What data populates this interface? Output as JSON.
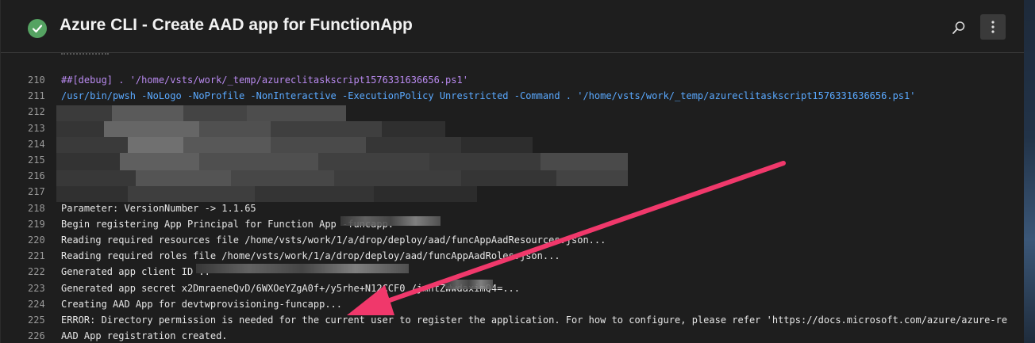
{
  "header": {
    "title": "Azure CLI - Create AAD app for FunctionApp",
    "status_icon": "success-check-icon",
    "search_icon": "search-icon",
    "more_icon": "more-vertical-icon"
  },
  "colors": {
    "success": "#55a362",
    "debug_text": "#b98af0",
    "command_text": "#5aa9ff",
    "arrow": "#f0386b"
  },
  "log": {
    "lines": [
      {
        "n": "210",
        "text": "##[debug]   . '/home/vsts/work/_temp/azureclitaskscript1576331636656.ps1'",
        "style": "debug"
      },
      {
        "n": "211",
        "text": "/usr/bin/pwsh -NoLogo -NoProfile -NonInteractive -ExecutionPolicy Unrestricted -Command . '/home/vsts/work/_temp/azureclitaskscript1576331636656.ps1'",
        "style": "cmd"
      },
      {
        "n": "212",
        "text": "",
        "style": "redacted"
      },
      {
        "n": "213",
        "text": "",
        "style": "redacted"
      },
      {
        "n": "214",
        "text": "",
        "style": "redacted"
      },
      {
        "n": "215",
        "text": "",
        "style": "redacted"
      },
      {
        "n": "216",
        "text": "",
        "style": "redacted"
      },
      {
        "n": "217",
        "text": "",
        "style": "redacted"
      },
      {
        "n": "218",
        "text": "Parameter: VersionNumber -> 1.1.65",
        "style": "normal"
      },
      {
        "n": "219",
        "text": "Begin registering App Principal for Function App              -funcapp.",
        "style": "normal"
      },
      {
        "n": "220",
        "text": "Reading required resources file /home/vsts/work/1/a/drop/deploy/aad/funcAppAadResources.json...",
        "style": "normal"
      },
      {
        "n": "221",
        "text": "Reading required roles file /home/vsts/work/1/a/drop/deploy/aad/funcAppAadRoles.json...",
        "style": "normal"
      },
      {
        "n": "222",
        "text": "Generated app client ID                                       ..",
        "style": "normal"
      },
      {
        "n": "223",
        "text": "Generated app secret x2DmraeneQvD/6WXOeYZgA0f+/y5rhe+N12CCF0        /jmntZWwdaximQ4=...",
        "style": "normal"
      },
      {
        "n": "224",
        "text": "Creating AAD App for devtwprovisioning-funcapp...",
        "style": "normal"
      },
      {
        "n": "225",
        "text": "ERROR: Directory permission is needed for the current user to register the application. For how to configure, please refer 'https://docs.microsoft.com/azure/azure-re",
        "style": "normal"
      },
      {
        "n": "226",
        "text": "AAD App registration created.",
        "style": "normal"
      }
    ]
  }
}
